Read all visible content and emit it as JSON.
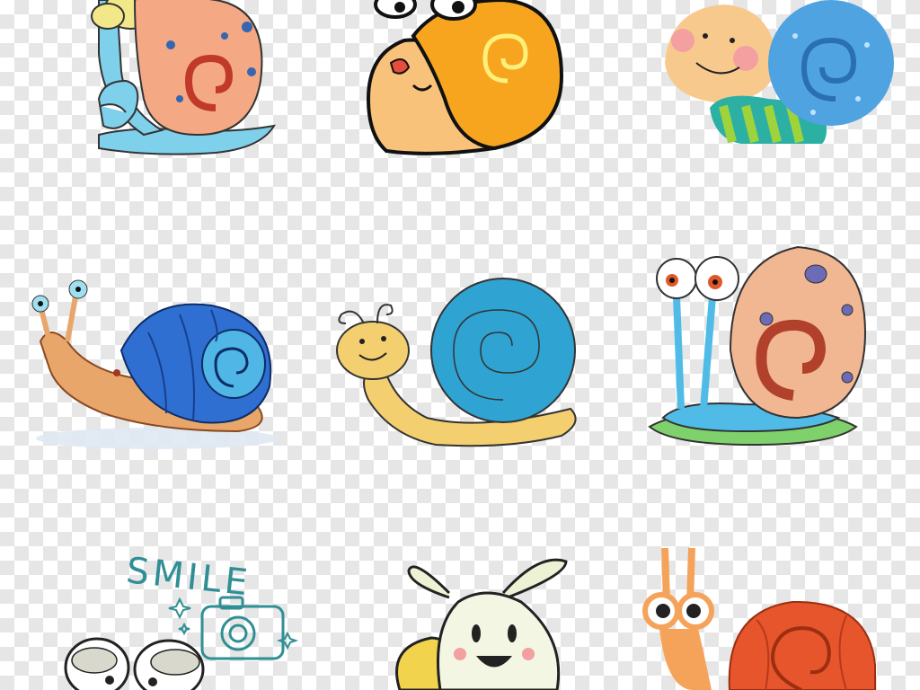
{
  "image": {
    "description_colors": {
      "checker_light": "#ffffff",
      "checker_dark": "#e6e6e6",
      "teal_ink": "#2f8f95"
    },
    "smile_text": "SMILE",
    "clipart_items": [
      "snail-1-orange-spotted",
      "snail-2-yellow-big-eyes",
      "snail-3-blue-polka-shell",
      "snail-4-blue-shell-realistic",
      "snail-5-blue-spiral-yellow-body",
      "snail-6-brown-spiral-googly-eyes",
      "smile-camera-doodle",
      "snail-7-white-face-antennae",
      "snail-8-orange-shell"
    ]
  }
}
